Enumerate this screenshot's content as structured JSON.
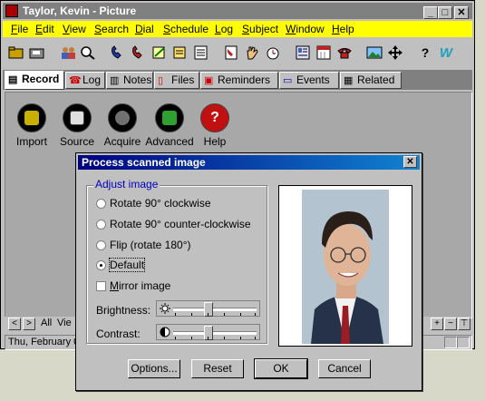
{
  "window": {
    "title": "Taylor, Kevin - Picture",
    "buttons": [
      "_",
      "□",
      "✕"
    ]
  },
  "menu": [
    {
      "u": "F",
      "rest": "ile"
    },
    {
      "u": "E",
      "rest": "dit"
    },
    {
      "u": "V",
      "rest": "iew"
    },
    {
      "u": "S",
      "rest": "earch"
    },
    {
      "u": "D",
      "rest": "ial"
    },
    {
      "u": "S",
      "rest": "chedule"
    },
    {
      "u": "L",
      "rest": "og"
    },
    {
      "u": "S",
      "rest": "ubject"
    },
    {
      "u": "W",
      "rest": "indow"
    },
    {
      "u": "H",
      "rest": "elp"
    }
  ],
  "toolbar": {
    "help_glyph": "?",
    "w_glyph": "W"
  },
  "tabs": [
    {
      "label": "Record"
    },
    {
      "label": "Log"
    },
    {
      "label": "Notes"
    },
    {
      "label": "Files"
    },
    {
      "label": "Reminders"
    },
    {
      "label": "Events"
    },
    {
      "label": "Related"
    }
  ],
  "actions": [
    {
      "label": "Import"
    },
    {
      "label": "Source"
    },
    {
      "label": "Acquire"
    },
    {
      "label": "Advanced"
    },
    {
      "label": "Help"
    }
  ],
  "nav": {
    "all_label": "All",
    "view_label": "Vie",
    "plus": "+",
    "minus": "−",
    "pin": "⊤",
    "prev": "<",
    "next": ">"
  },
  "status": {
    "date": "Thu, February 0"
  },
  "dialog": {
    "title": "Process scanned image",
    "close": "✕",
    "group_label": "Adjust image",
    "options": [
      {
        "label": "Rotate 90° clockwise",
        "selected": false
      },
      {
        "label": "Rotate 90° counter-clockwise",
        "selected": false
      },
      {
        "label": "Flip (rotate 180°)",
        "selected": false
      },
      {
        "label": "Default",
        "selected": true
      }
    ],
    "mirror_label": "Mirror image",
    "mirror_u": "M",
    "mirror_rest": "irror image",
    "mirror_checked": false,
    "brightness_label": "Brightness:",
    "contrast_label": "Contrast:",
    "buttons": {
      "options": "Options...",
      "reset": "Reset",
      "ok": "OK",
      "cancel": "Cancel"
    }
  }
}
